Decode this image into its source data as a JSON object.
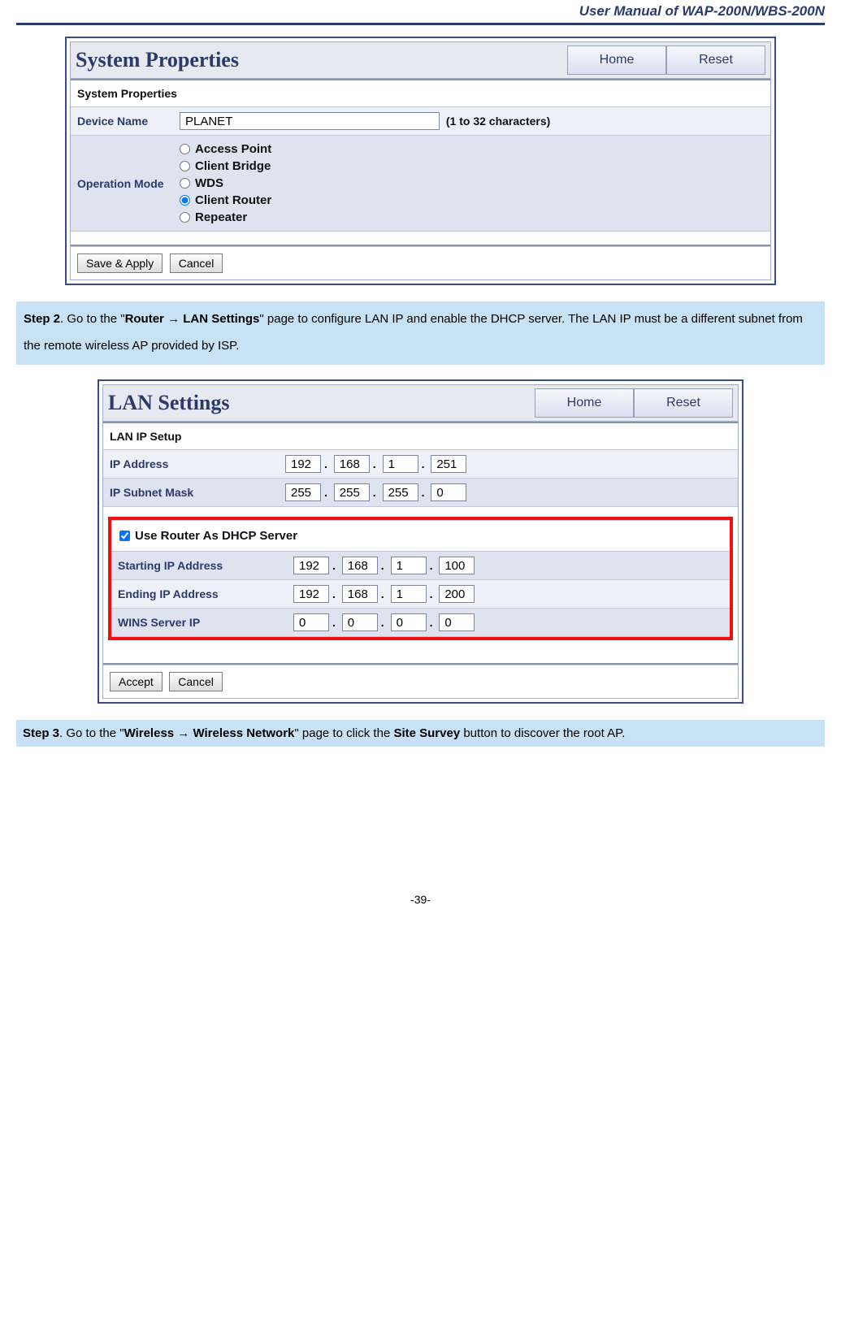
{
  "header": {
    "title": "User Manual of WAP-200N/WBS-200N"
  },
  "panel1": {
    "title": "System Properties",
    "home_btn": "Home",
    "reset_btn": "Reset",
    "section": "System Properties",
    "device_name_label": "Device Name",
    "device_name_value": "PLANET",
    "device_name_hint": "(1 to 32 characters)",
    "op_mode_label": "Operation Mode",
    "modes": {
      "ap": "Access Point",
      "cb": "Client Bridge",
      "wds": "WDS",
      "cr": "Client Router",
      "rp": "Repeater"
    },
    "save_btn": "Save & Apply",
    "cancel_btn": "Cancel"
  },
  "step2": {
    "step_label": "Step 2",
    "text_a": ". Go to the \"",
    "nav": "Router → LAN Settings",
    "text_b": "\" page to configure LAN IP and enable the DHCP server. The LAN IP must be a different subnet from the remote wireless AP provided by ISP."
  },
  "panel2": {
    "title": "LAN Settings",
    "home_btn": "Home",
    "reset_btn": "Reset",
    "section": "LAN IP Setup",
    "ip_label": "IP Address",
    "ip": [
      "192",
      "168",
      "1",
      "251"
    ],
    "mask_label": "IP Subnet Mask",
    "mask": [
      "255",
      "255",
      "255",
      "0"
    ],
    "dhcp_label": "Use Router As DHCP Server",
    "start_label": "Starting IP Address",
    "start": [
      "192",
      "168",
      "1",
      "100"
    ],
    "end_label": "Ending IP Address",
    "end": [
      "192",
      "168",
      "1",
      "200"
    ],
    "wins_label": "WINS Server IP",
    "wins": [
      "0",
      "0",
      "0",
      "0"
    ],
    "accept_btn": "Accept",
    "cancel_btn": "Cancel"
  },
  "step3": {
    "step_label": "Step 3",
    "text_a": ". Go to the \"",
    "nav": "Wireless → Wireless Network",
    "text_b": "\" page to click the ",
    "site_survey": "Site Survey",
    "text_c": " button to discover the root AP."
  },
  "footer": {
    "page": "-39-"
  }
}
